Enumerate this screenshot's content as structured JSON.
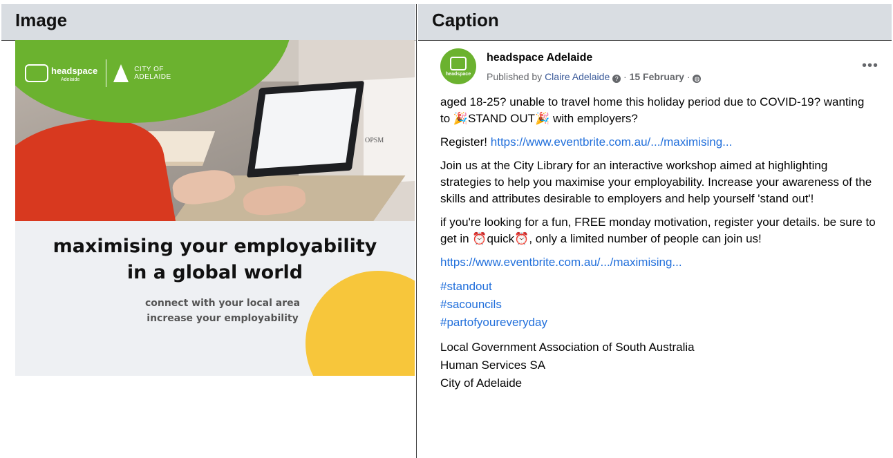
{
  "headers": {
    "image": "Image",
    "caption": "Caption"
  },
  "promo": {
    "brand_name": "headspace",
    "brand_sub": "Adelaide",
    "partner_line1": "CITY OF",
    "partner_line2": "ADELAIDE",
    "bag_text": "OPSM",
    "headline_line1": "maximising your employability",
    "headline_line2": "in a global world",
    "subline_line1": "connect with your local area",
    "subline_line2": "increase your employability",
    "colors": {
      "green": "#6bb22f",
      "yellow": "#f7c63b",
      "background": "#eef0f3"
    }
  },
  "post": {
    "page_name": "headspace Adelaide",
    "avatar_text": "headspace",
    "published_by_prefix": "Published by",
    "published_by": "Claire Adelaide",
    "date": "15 February",
    "more_label": "•••",
    "p1_text": "aged 18-25? unable to travel home this holiday period due to COVID-19? wanting to",
    "p1_emphasis": "STAND OUT",
    "p1_suffix": "with employers?",
    "register_label": "Register!",
    "register_link": "https://www.eventbrite.com.au/.../maximising...",
    "p3": "Join us at the City Library for an interactive workshop aimed at highlighting strategies to help you maximise your employability. Increase your awareness of the skills and attributes desirable to employers and help yourself 'stand out'!",
    "p4_prefix": "if you're looking for a fun, FREE monday motivation, register your details. be sure to get in",
    "p4_quick": "quick",
    "p4_suffix": ", only a limited number of people can join us!",
    "link2": "https://www.eventbrite.com.au/.../maximising...",
    "hashtags": [
      "#standout",
      "#sacouncils",
      "#partofyoureveryday"
    ],
    "tagged": [
      "Local Government Association of South Australia",
      "Human Services SA",
      "City of Adelaide"
    ]
  }
}
